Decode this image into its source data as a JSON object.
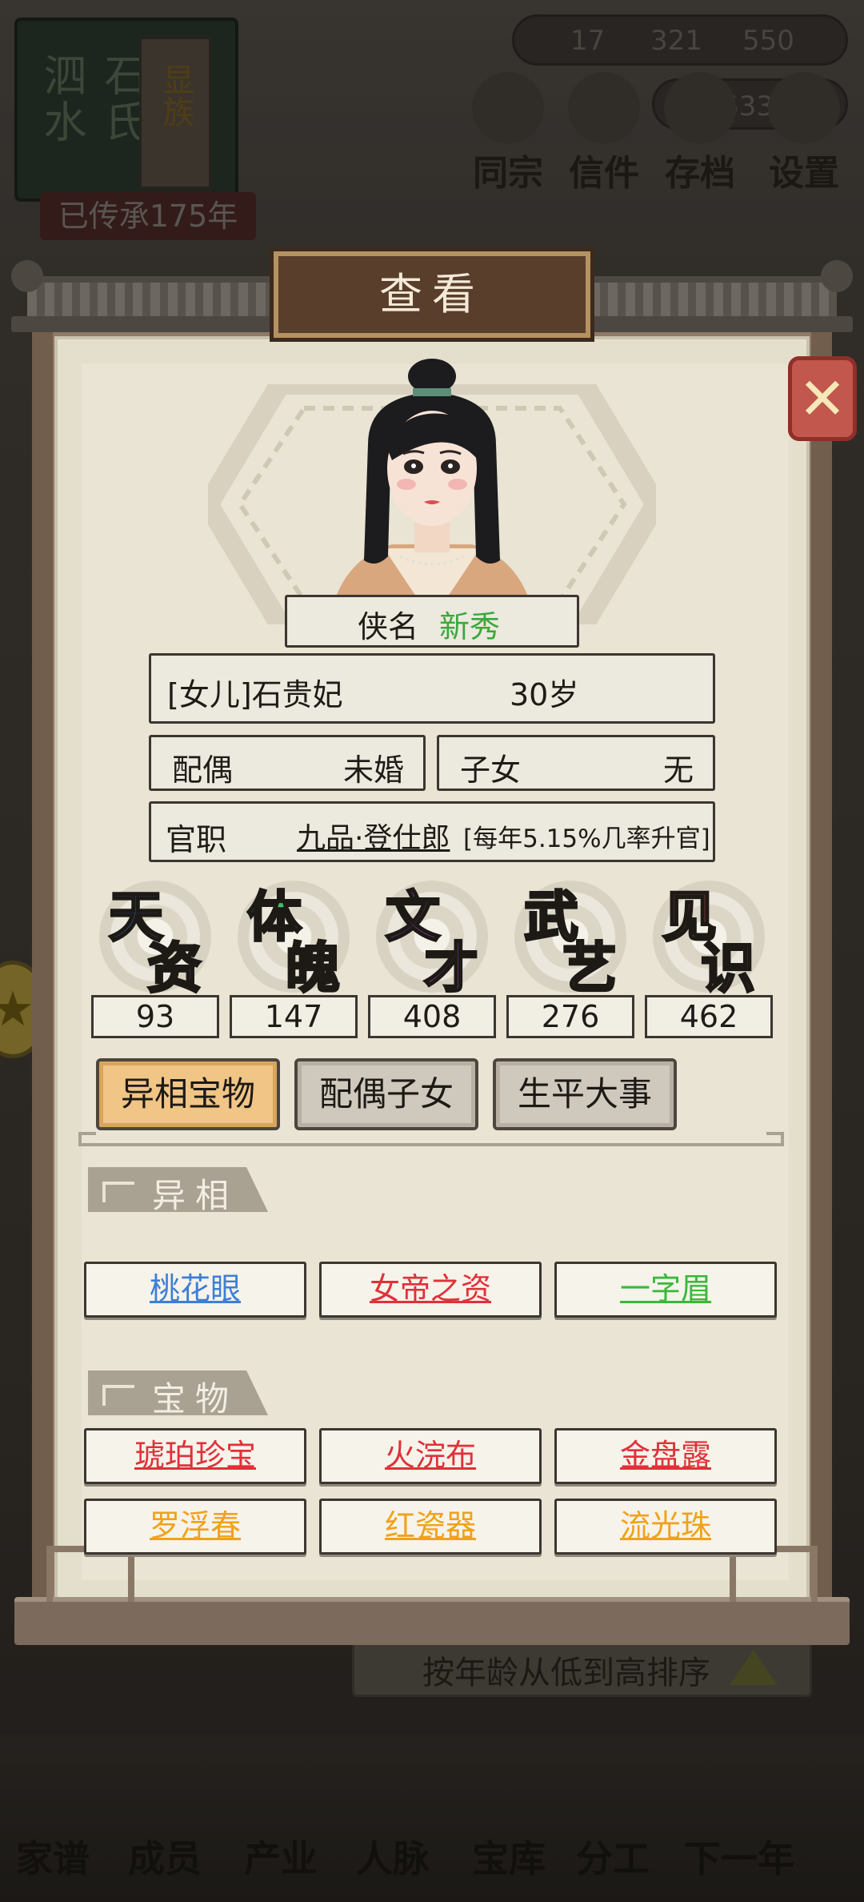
{
  "background": {
    "clan_name_left": "泗水",
    "clan_name_right": "石氏",
    "clan_slip": "显族",
    "inherit_text": "已传承175年",
    "resources": [
      "17",
      "321",
      "550"
    ],
    "gold": "533",
    "top_icons": [
      "同宗",
      "信件",
      "存档",
      "设置"
    ],
    "sort_label": "按年龄从低到高排序",
    "bottom_nav": [
      "家谱",
      "成员",
      "产业",
      "人脉",
      "宝库",
      "分工",
      "下一年"
    ]
  },
  "modal": {
    "title": "查看",
    "close_label": "✕",
    "nickname_label": "侠名",
    "nickname_value": "新秀",
    "identity": "[女儿]石贵妃",
    "age": "30岁",
    "spouse_label": "配偶",
    "spouse_value": "未婚",
    "children_label": "子女",
    "children_value": "无",
    "office_label": "官职",
    "office_rank": "九品·登仕郎",
    "office_note": "[每年5.15%几率升官]",
    "attributes": [
      {
        "c1": "天",
        "c2": "资",
        "value": "93",
        "color": "#3d6ee0"
      },
      {
        "c1": "体",
        "c2": "魄",
        "value": "147",
        "color": "#3fbf6a"
      },
      {
        "c1": "文",
        "c2": "才",
        "value": "408",
        "color": "#b04ad6"
      },
      {
        "c1": "武",
        "c2": "艺",
        "value": "276",
        "color": "#f0a63a"
      },
      {
        "c1": "见",
        "c2": "识",
        "value": "462",
        "color": "#e85a55"
      }
    ],
    "tabs": [
      "异相宝物",
      "配偶子女",
      "生平大事"
    ],
    "active_tab": "异相宝物",
    "section_traits": "异相",
    "traits": [
      {
        "name": "桃花眼",
        "color": "#3e7fd6"
      },
      {
        "name": "女帝之资",
        "color": "#e0313a"
      },
      {
        "name": "一字眉",
        "color": "#39b83a"
      }
    ],
    "section_treasures": "宝物",
    "treasures": [
      {
        "name": "琥珀珍宝",
        "color": "#e0313a"
      },
      {
        "name": "火浣布",
        "color": "#e0313a"
      },
      {
        "name": "金盘露",
        "color": "#e0313a"
      },
      {
        "name": "罗浮春",
        "color": "#f0a21a"
      },
      {
        "name": "红瓷器",
        "color": "#f0a21a"
      },
      {
        "name": "流光珠",
        "color": "#f0a21a"
      }
    ]
  }
}
